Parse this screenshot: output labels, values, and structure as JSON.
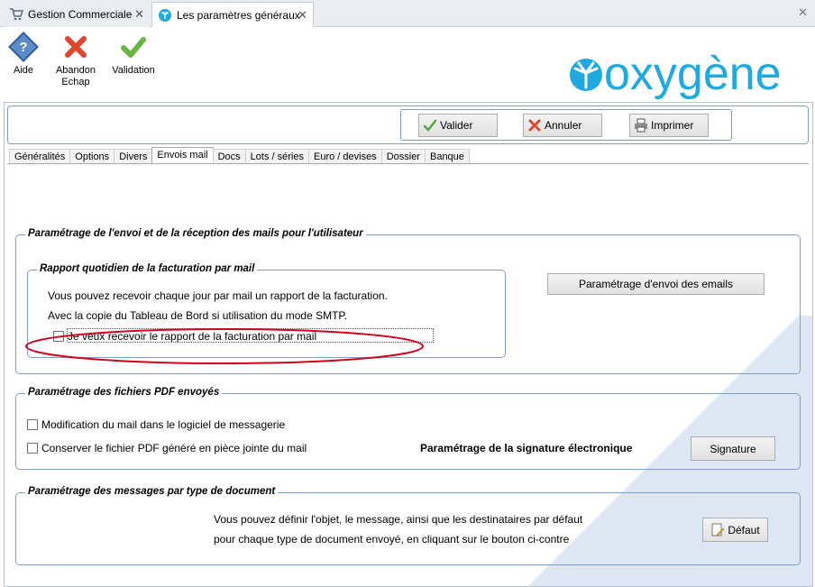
{
  "tabs": [
    {
      "label": "Gestion Commerciale",
      "icon": "cart-icon"
    },
    {
      "label": "Les paramètres généraux",
      "icon": "oxygene-palm-icon"
    }
  ],
  "toolbar": {
    "aide": "Aide",
    "abandon_line1": "Abandon",
    "abandon_line2": "Echap",
    "validation": "Validation"
  },
  "logo": {
    "text": "oxygène",
    "color": "#1ea9e0"
  },
  "actions": {
    "valider": "Valider",
    "annuler": "Annuler",
    "imprimer": "Imprimer"
  },
  "form_tabs": [
    "Généralités",
    "Options",
    "Divers",
    "Envois mail",
    "Docs",
    "Lots / séries",
    "Euro / devises",
    "Dossier",
    "Banque"
  ],
  "active_tab": "Envois mail",
  "mail_section": {
    "title": "Paramétrage de l'envoi et de la réception des mails pour l'utilisateur",
    "report_group_title": "Rapport quotidien de la facturation par mail",
    "line1": "Vous pouvez recevoir chaque jour par mail un rapport de la facturation.",
    "line2": "Avec la copie du Tableau de Bord si utilisation du mode SMTP.",
    "checkbox_label": "Je veux recevoir le rapport de la facturation par mail",
    "checkbox_checked": false,
    "email_settings_button": "Paramétrage d'envoi des emails"
  },
  "pdf_section": {
    "title": "Paramétrage des fichiers PDF envoyés",
    "check1": "Modification du mail dans le logiciel de messagerie",
    "check2": "Conserver le fichier PDF généré en pièce jointe du mail",
    "signature_label": "Paramétrage de la signature électronique",
    "signature_button": "Signature"
  },
  "messages_section": {
    "title": "Paramétrage des messages par type de document",
    "line1": "Vous pouvez définir l'objet, le message, ainsi que les destinataires par défaut",
    "line2": "pour chaque type de document envoyé, en cliquant sur le bouton ci-contre",
    "default_button": "Défaut"
  },
  "colors": {
    "accent": "#7d9fc7",
    "highlight_ellipse": "#d0021b",
    "logo": "#1ea9e0"
  }
}
